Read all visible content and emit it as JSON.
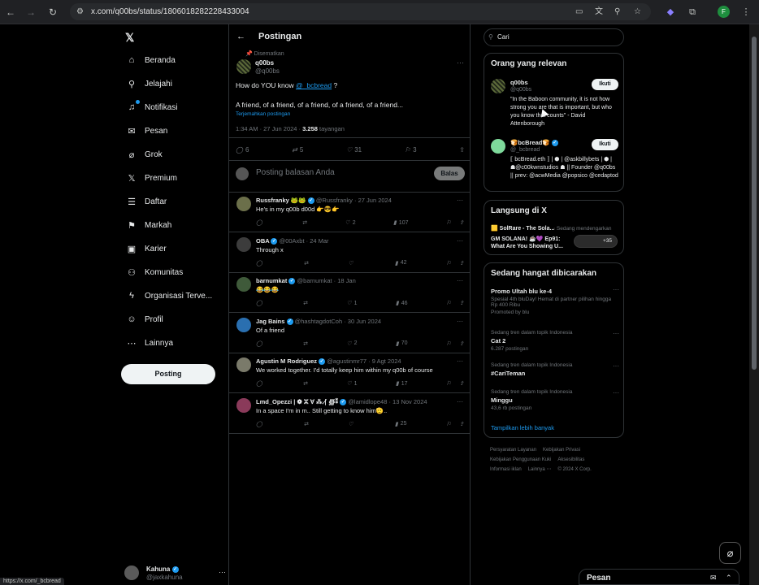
{
  "browser": {
    "url": "x.com/q00bs/status/1806018282228433004",
    "profile_initial": "F",
    "status_url": "https://x.com/_bcbread"
  },
  "sidebar": {
    "logo": "𝕏",
    "items": [
      {
        "label": "Beranda",
        "icon": "⌂"
      },
      {
        "label": "Jelajahi",
        "icon": "⚲"
      },
      {
        "label": "Notifikasi",
        "icon": "♫"
      },
      {
        "label": "Pesan",
        "icon": "✉"
      },
      {
        "label": "Grok",
        "icon": "⌀"
      },
      {
        "label": "Premium",
        "icon": "𝕏"
      },
      {
        "label": "Daftar",
        "icon": "☰"
      },
      {
        "label": "Markah",
        "icon": "⚑"
      },
      {
        "label": "Karier",
        "icon": "▣"
      },
      {
        "label": "Komunitas",
        "icon": "⚇"
      },
      {
        "label": "Organisasi Terve...",
        "icon": "ϟ"
      },
      {
        "label": "Profil",
        "icon": "☺"
      },
      {
        "label": "Lainnya",
        "icon": "⋯"
      }
    ],
    "post_button": "Posting",
    "account": {
      "name": "Kahuna",
      "handle": "@jaxkahuna"
    }
  },
  "main": {
    "title": "Postingan",
    "pinned_label": "Disematkan",
    "tweet": {
      "name": "q00bs",
      "handle": "@q00bs",
      "text_before": "How do YOU know ",
      "mention": "@_bcbread",
      "text_after": " ?",
      "text2": "A friend, of a friend, of a friend, of a friend, of a friend...",
      "translate": "Terjemahkan postingan",
      "time": "1:34 AM · 27 Jun 2024 · ",
      "views": "3.258",
      "views_label": " tayangan",
      "replies": "6",
      "reposts": "5",
      "likes": "31",
      "bookmarks": "3"
    },
    "reply_placeholder": "Posting balasan Anda",
    "reply_button": "Balas",
    "replies": [
      {
        "name": "Russfranky 🐸🐸",
        "handle": "@Russfranky · 27 Jun 2024",
        "text": "He's in my q00b d00d 👉😎👉",
        "replies": "",
        "likes": "2",
        "views": "107",
        "color": "#6b6f4a"
      },
      {
        "name": "OBA",
        "handle": "@00Axbt · 24 Mar",
        "text": "Through x",
        "replies": "",
        "likes": "",
        "views": "42",
        "color": "#3c3c3c"
      },
      {
        "name": "barnumkat",
        "handle": "@barnumkat · 18 Jan",
        "text": "😂😂😂",
        "replies": "",
        "likes": "1",
        "views": "46",
        "color": "#3f5a3a"
      },
      {
        "name": "Jag Bains",
        "handle": "@hashtagdotCoh · 30 Jun 2024",
        "text": "Of a friend",
        "replies": "",
        "likes": "2",
        "views": "70",
        "color": "#2a6fb0"
      },
      {
        "name": "Agustin M Rodriguez",
        "handle": "@agustinmr77 · 9 Agt 2024",
        "text": "We worked together. I'd totally keep him within my q00b of course",
        "replies": "",
        "likes": "1",
        "views": "17",
        "color": "#7a7a6a"
      },
      {
        "name": "Lmd_Opezzi | ❁ ⵣ ∀ ⁂ ∤ ∰⁑",
        "handle": "@lamidlope48 · 13 Nov 2024",
        "text": "In a space I'm in m.. Still getting to know him🫡..",
        "replies": "",
        "likes": "",
        "views": "25",
        "color": "#8a3a5a"
      }
    ]
  },
  "right": {
    "search_value": "Cari",
    "relevant_title": "Orang yang relevan",
    "relevant": [
      {
        "name": "q00bs",
        "handle": "@q00bs",
        "follow": "Ikuti",
        "bio": "\"In the Baboon community, it is not how strong you are that is important, but who you know that counts\" - David Attenborough"
      },
      {
        "name": "🍞bcBread🍞",
        "handle": "@_bcbread",
        "follow": "Ikuti",
        "bio": "⟦ bcBread.eth ⟧ | ⬢ | @askbillybets | ⬢ | ☗@c00kwnstudios ☗ || Founder @q00bs || prev: @acwMedia @popsico @cedaptod"
      }
    ],
    "live_title": "Langsung di X",
    "live": {
      "host": "🟨 SolRare - The Sola...",
      "status": "⋅ Sedang mendengarkan",
      "line1": "GM SOLANA! ☕💜 Ep91:",
      "line2": "What Are You Showing U...",
      "count": "+35"
    },
    "trending_title": "Sedang hangat dibicarakan",
    "trends": [
      {
        "context": "",
        "title": "Promo Ultah blu ke-4",
        "count": "Spesial 4th bluDay! Hemat di partner pilihan hingga Rp 400 Ribu",
        "extra": "Promoted by blu"
      },
      {
        "context": "Sedang tren dalam topik Indonesia",
        "title": "Cat 2",
        "count": "6.287 postingan",
        "extra": ""
      },
      {
        "context": "Sedang tren dalam topik Indonesia",
        "title": "#CariTeman",
        "count": "",
        "extra": ""
      },
      {
        "context": "Sedang tren dalam topik Indonesia",
        "title": "Minggu",
        "count": "43,6 rb postingan",
        "extra": ""
      }
    ],
    "show_more": "Tampilkan lebih banyak",
    "footer": [
      "Persyaratan Layanan",
      "Kebijakan Privasi",
      "Kebijakan Penggunaan Kuki",
      "Aksesibilitas",
      "Informasi iklan",
      "Lainnya ⋯",
      "© 2024 X Corp."
    ]
  },
  "drawer": {
    "label": "Pesan"
  }
}
